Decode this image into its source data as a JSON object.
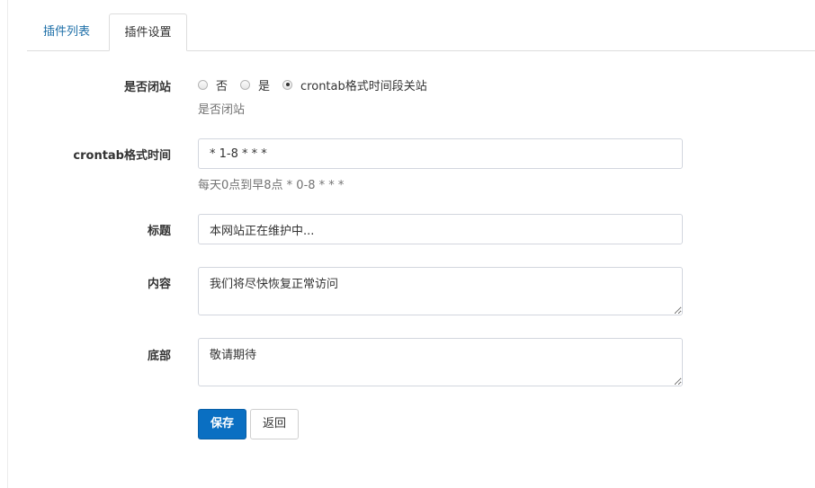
{
  "tabs": {
    "plugin_list": "插件列表",
    "plugin_settings": "插件设置"
  },
  "form": {
    "close_site": {
      "label": "是否闭站",
      "options": [
        "否",
        "是",
        "crontab格式时间段关站"
      ],
      "selected": "crontab格式时间段关站",
      "help": "是否闭站"
    },
    "crontab": {
      "label": "crontab格式时间",
      "value": "* 1-8 * * *",
      "help": "每天0点到早8点 * 0-8 * * *"
    },
    "title": {
      "label": "标题",
      "value": "本网站正在维护中..."
    },
    "content": {
      "label": "内容",
      "value": "我们将尽快恢复正常访问"
    },
    "footer": {
      "label": "底部",
      "value": "敬请期待"
    }
  },
  "buttons": {
    "save": "保存",
    "back": "返回"
  },
  "colors": {
    "primary": "#0a6fc2",
    "tab_link": "#1e6fa8",
    "border": "#d2d6de",
    "help_text": "#737373"
  }
}
